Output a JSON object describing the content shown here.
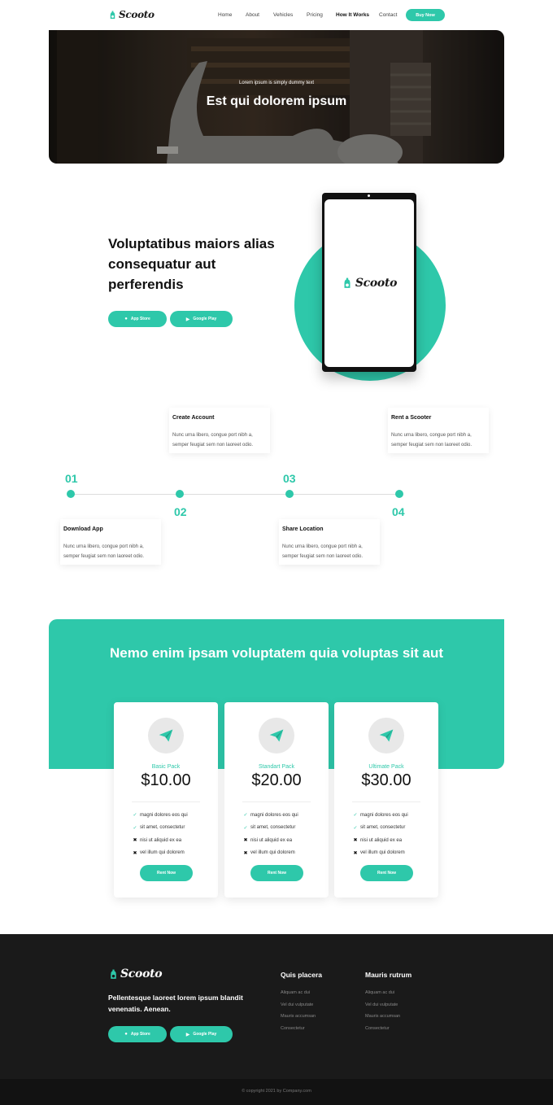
{
  "brand": {
    "name": "Scooto",
    "accent": "#2ec8aa",
    "dark": "#1a1a1a"
  },
  "nav": {
    "links": [
      "Home",
      "About",
      "Vehicles",
      "Pricing",
      "How It Works",
      "Contact"
    ],
    "active": "How It Works",
    "cta": "Buy Now"
  },
  "hero": {
    "subtitle": "Lorem ipsum is simply dummy text",
    "title": "Est qui dolorem ipsum"
  },
  "app_section": {
    "title": "Voluptatibus maiors alias consequatur aut perferendis",
    "app_store_label": "App Store",
    "google_play_label": "Google Play"
  },
  "steps": [
    {
      "num": "01",
      "title": "Download App",
      "text": "Nunc urna libero, congue port nibh a, semper feugiat sem non laoreet odio."
    },
    {
      "num": "02",
      "title": "Create Account",
      "text": "Nunc urna libero, congue port nibh a, semper feugiat sem non laoreet odio."
    },
    {
      "num": "03",
      "title": "Share Location",
      "text": "Nunc urna libero, congue port nibh a, semper feugiat sem non laoreet odio."
    },
    {
      "num": "04",
      "title": "Rent a Scooter",
      "text": "Nunc urna libero, congue port nibh a, semper feugiat sem non laoreet odio."
    }
  ],
  "pricing": {
    "title": "Nemo enim ipsam voluptatem quia voluptas sit aut",
    "plans": [
      {
        "name": "Basic Pack",
        "price": "$10.00",
        "button": "Rent Now",
        "features": [
          {
            "text": "magni dolores eos qui",
            "included": true
          },
          {
            "text": "sit amet, consectetur",
            "included": true
          },
          {
            "text": "nisi ut aliquid ex ea",
            "included": false
          },
          {
            "text": "vel illum qui dolorem",
            "included": false
          }
        ]
      },
      {
        "name": "Standart Pack",
        "price": "$20.00",
        "button": "Rent Now",
        "features": [
          {
            "text": "magni dolores eos qui",
            "included": true
          },
          {
            "text": "sit amet, consectetur",
            "included": true
          },
          {
            "text": "nisi ut aliquid ex ea",
            "included": false
          },
          {
            "text": "vel illum qui dolorem",
            "included": false
          }
        ]
      },
      {
        "name": "Ultimate Pack",
        "price": "$30.00",
        "button": "Rent Now",
        "features": [
          {
            "text": "magni dolores eos qui",
            "included": true
          },
          {
            "text": "sit amet, consectetur",
            "included": true
          },
          {
            "text": "nisi ut aliquid ex ea",
            "included": false
          },
          {
            "text": "vel illum qui dolorem",
            "included": false
          }
        ]
      }
    ]
  },
  "footer": {
    "tagline": "Pellentesque laoreet lorem ipsum blandit venenatis. Aenean.",
    "app_store_label": "App Store",
    "google_play_label": "Google Play",
    "columns": [
      {
        "title": "Quis placera",
        "links": [
          "Aliquam ac dui",
          "Vel dui vulputate",
          "Mauris accumsan",
          "Consectetur"
        ]
      },
      {
        "title": "Mauris rutrum",
        "links": [
          "Aliquam ac dui",
          "Vel dui vulputate",
          "Mauris accumsan",
          "Consectetur"
        ]
      }
    ],
    "copyright": "© copyright 2021 by Company.com"
  }
}
